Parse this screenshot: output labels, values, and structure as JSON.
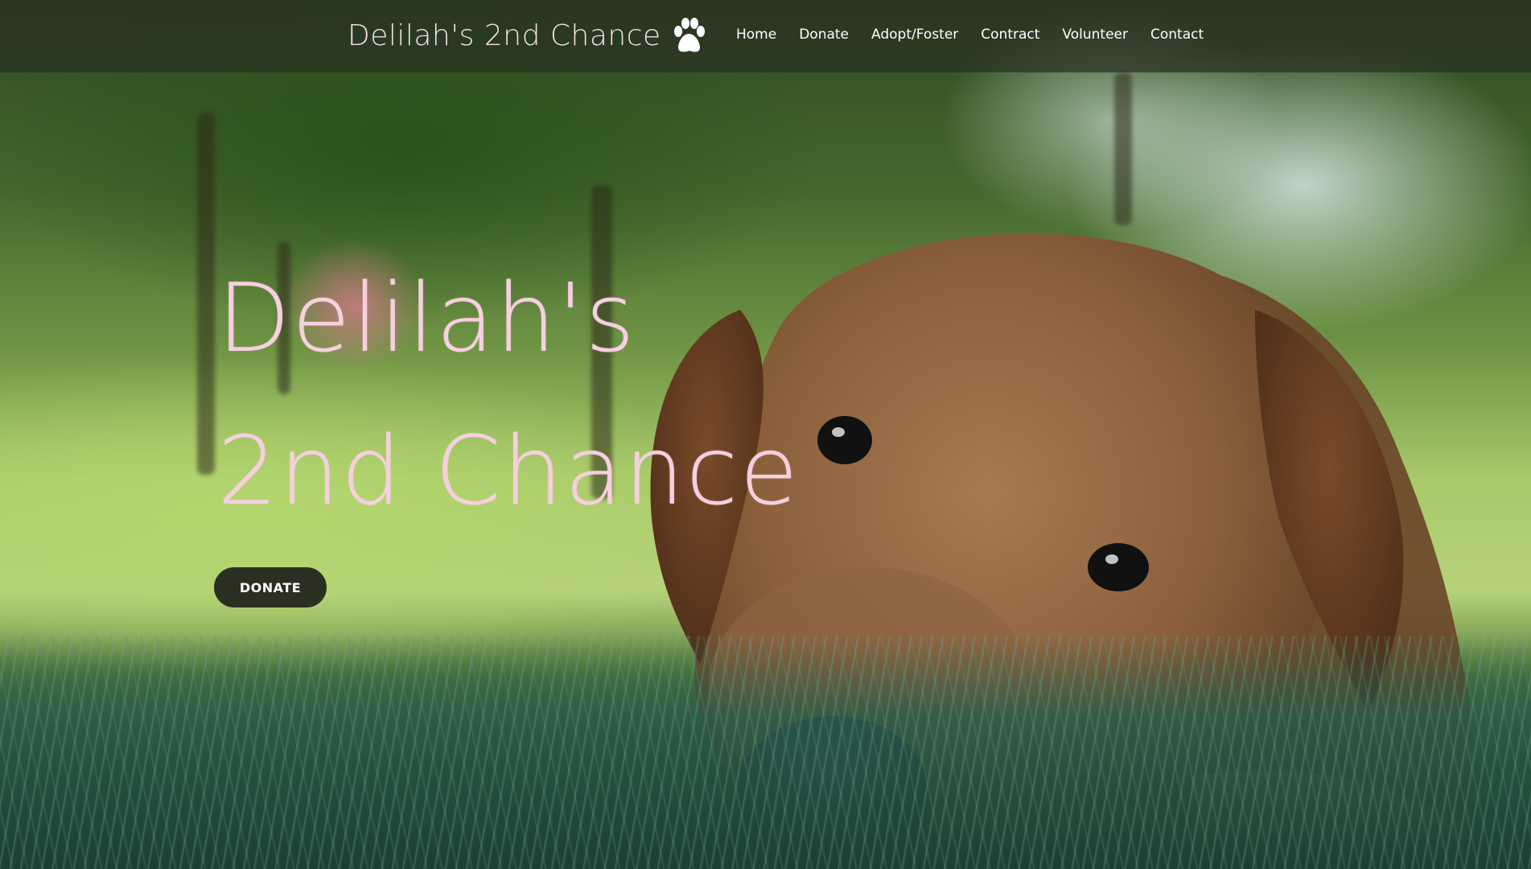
{
  "site": {
    "brand_name": "Delilah's 2nd Chance",
    "brand_icon": "paw-print-icon"
  },
  "nav": {
    "items": [
      {
        "label": "Home"
      },
      {
        "label": "Donate"
      },
      {
        "label": "Adopt/Foster"
      },
      {
        "label": "Contract"
      },
      {
        "label": "Volunteer"
      },
      {
        "label": "Contact"
      }
    ]
  },
  "hero": {
    "headline_line1": "Delilah's",
    "headline_line2": "2nd Chance",
    "cta_label": "DONATE",
    "background_subject": "golden-retriever-on-grass-photo"
  },
  "colors": {
    "headline": "#f8cfe0",
    "brand_text": "#f3dde6",
    "nav_bar": "#283022",
    "button_bg": "#2b2f22",
    "button_text": "#ffffff"
  }
}
